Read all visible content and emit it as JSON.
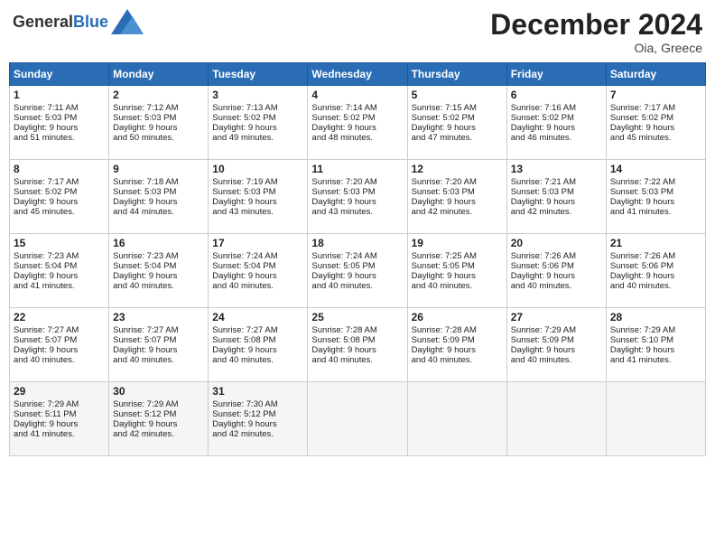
{
  "header": {
    "logo_general": "General",
    "logo_blue": "Blue",
    "month_title": "December 2024",
    "subtitle": "Oia, Greece"
  },
  "days_of_week": [
    "Sunday",
    "Monday",
    "Tuesday",
    "Wednesday",
    "Thursday",
    "Friday",
    "Saturday"
  ],
  "weeks": [
    [
      {
        "day": "1",
        "lines": [
          "Sunrise: 7:11 AM",
          "Sunset: 5:03 PM",
          "Daylight: 9 hours",
          "and 51 minutes."
        ]
      },
      {
        "day": "2",
        "lines": [
          "Sunrise: 7:12 AM",
          "Sunset: 5:03 PM",
          "Daylight: 9 hours",
          "and 50 minutes."
        ]
      },
      {
        "day": "3",
        "lines": [
          "Sunrise: 7:13 AM",
          "Sunset: 5:02 PM",
          "Daylight: 9 hours",
          "and 49 minutes."
        ]
      },
      {
        "day": "4",
        "lines": [
          "Sunrise: 7:14 AM",
          "Sunset: 5:02 PM",
          "Daylight: 9 hours",
          "and 48 minutes."
        ]
      },
      {
        "day": "5",
        "lines": [
          "Sunrise: 7:15 AM",
          "Sunset: 5:02 PM",
          "Daylight: 9 hours",
          "and 47 minutes."
        ]
      },
      {
        "day": "6",
        "lines": [
          "Sunrise: 7:16 AM",
          "Sunset: 5:02 PM",
          "Daylight: 9 hours",
          "and 46 minutes."
        ]
      },
      {
        "day": "7",
        "lines": [
          "Sunrise: 7:17 AM",
          "Sunset: 5:02 PM",
          "Daylight: 9 hours",
          "and 45 minutes."
        ]
      }
    ],
    [
      {
        "day": "8",
        "lines": [
          "Sunrise: 7:17 AM",
          "Sunset: 5:02 PM",
          "Daylight: 9 hours",
          "and 45 minutes."
        ]
      },
      {
        "day": "9",
        "lines": [
          "Sunrise: 7:18 AM",
          "Sunset: 5:03 PM",
          "Daylight: 9 hours",
          "and 44 minutes."
        ]
      },
      {
        "day": "10",
        "lines": [
          "Sunrise: 7:19 AM",
          "Sunset: 5:03 PM",
          "Daylight: 9 hours",
          "and 43 minutes."
        ]
      },
      {
        "day": "11",
        "lines": [
          "Sunrise: 7:20 AM",
          "Sunset: 5:03 PM",
          "Daylight: 9 hours",
          "and 43 minutes."
        ]
      },
      {
        "day": "12",
        "lines": [
          "Sunrise: 7:20 AM",
          "Sunset: 5:03 PM",
          "Daylight: 9 hours",
          "and 42 minutes."
        ]
      },
      {
        "day": "13",
        "lines": [
          "Sunrise: 7:21 AM",
          "Sunset: 5:03 PM",
          "Daylight: 9 hours",
          "and 42 minutes."
        ]
      },
      {
        "day": "14",
        "lines": [
          "Sunrise: 7:22 AM",
          "Sunset: 5:03 PM",
          "Daylight: 9 hours",
          "and 41 minutes."
        ]
      }
    ],
    [
      {
        "day": "15",
        "lines": [
          "Sunrise: 7:23 AM",
          "Sunset: 5:04 PM",
          "Daylight: 9 hours",
          "and 41 minutes."
        ]
      },
      {
        "day": "16",
        "lines": [
          "Sunrise: 7:23 AM",
          "Sunset: 5:04 PM",
          "Daylight: 9 hours",
          "and 40 minutes."
        ]
      },
      {
        "day": "17",
        "lines": [
          "Sunrise: 7:24 AM",
          "Sunset: 5:04 PM",
          "Daylight: 9 hours",
          "and 40 minutes."
        ]
      },
      {
        "day": "18",
        "lines": [
          "Sunrise: 7:24 AM",
          "Sunset: 5:05 PM",
          "Daylight: 9 hours",
          "and 40 minutes."
        ]
      },
      {
        "day": "19",
        "lines": [
          "Sunrise: 7:25 AM",
          "Sunset: 5:05 PM",
          "Daylight: 9 hours",
          "and 40 minutes."
        ]
      },
      {
        "day": "20",
        "lines": [
          "Sunrise: 7:26 AM",
          "Sunset: 5:06 PM",
          "Daylight: 9 hours",
          "and 40 minutes."
        ]
      },
      {
        "day": "21",
        "lines": [
          "Sunrise: 7:26 AM",
          "Sunset: 5:06 PM",
          "Daylight: 9 hours",
          "and 40 minutes."
        ]
      }
    ],
    [
      {
        "day": "22",
        "lines": [
          "Sunrise: 7:27 AM",
          "Sunset: 5:07 PM",
          "Daylight: 9 hours",
          "and 40 minutes."
        ]
      },
      {
        "day": "23",
        "lines": [
          "Sunrise: 7:27 AM",
          "Sunset: 5:07 PM",
          "Daylight: 9 hours",
          "and 40 minutes."
        ]
      },
      {
        "day": "24",
        "lines": [
          "Sunrise: 7:27 AM",
          "Sunset: 5:08 PM",
          "Daylight: 9 hours",
          "and 40 minutes."
        ]
      },
      {
        "day": "25",
        "lines": [
          "Sunrise: 7:28 AM",
          "Sunset: 5:08 PM",
          "Daylight: 9 hours",
          "and 40 minutes."
        ]
      },
      {
        "day": "26",
        "lines": [
          "Sunrise: 7:28 AM",
          "Sunset: 5:09 PM",
          "Daylight: 9 hours",
          "and 40 minutes."
        ]
      },
      {
        "day": "27",
        "lines": [
          "Sunrise: 7:29 AM",
          "Sunset: 5:09 PM",
          "Daylight: 9 hours",
          "and 40 minutes."
        ]
      },
      {
        "day": "28",
        "lines": [
          "Sunrise: 7:29 AM",
          "Sunset: 5:10 PM",
          "Daylight: 9 hours",
          "and 41 minutes."
        ]
      }
    ],
    [
      {
        "day": "29",
        "lines": [
          "Sunrise: 7:29 AM",
          "Sunset: 5:11 PM",
          "Daylight: 9 hours",
          "and 41 minutes."
        ]
      },
      {
        "day": "30",
        "lines": [
          "Sunrise: 7:29 AM",
          "Sunset: 5:12 PM",
          "Daylight: 9 hours",
          "and 42 minutes."
        ]
      },
      {
        "day": "31",
        "lines": [
          "Sunrise: 7:30 AM",
          "Sunset: 5:12 PM",
          "Daylight: 9 hours",
          "and 42 minutes."
        ]
      },
      null,
      null,
      null,
      null
    ]
  ]
}
